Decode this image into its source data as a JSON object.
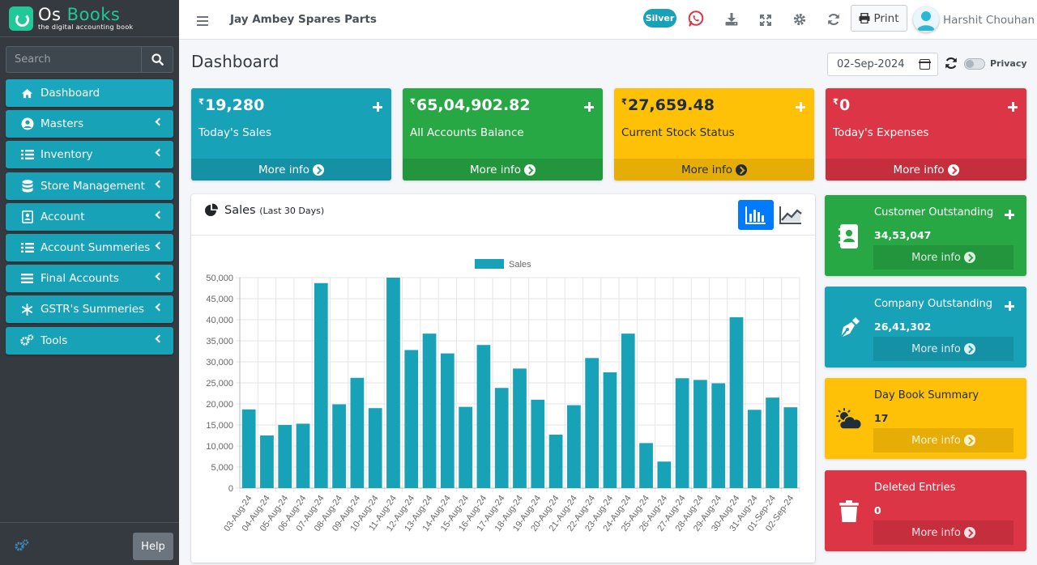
{
  "app": {
    "brand_os": "Os",
    "brand_books": "Books",
    "brand_sub": "the digital accounting book"
  },
  "search": {
    "placeholder": "Search"
  },
  "sidebar": {
    "items": [
      {
        "label": "Dashboard",
        "icon": "home-icon",
        "active": true
      },
      {
        "label": "Masters",
        "icon": "user-circle-icon"
      },
      {
        "label": "Inventory",
        "icon": "list-icon"
      },
      {
        "label": "Store Management",
        "icon": "database-icon"
      },
      {
        "label": "Account",
        "icon": "address-card-icon"
      },
      {
        "label": "Account Summeries",
        "icon": "list-icon"
      },
      {
        "label": "Final Accounts",
        "icon": "bars-icon"
      },
      {
        "label": "GSTR's Summeries",
        "icon": "snowflake-icon"
      },
      {
        "label": "Tools",
        "icon": "cogs-icon"
      }
    ],
    "help_label": "Help"
  },
  "topbar": {
    "company": "Jay Ambey Spares Parts",
    "plan_badge": "Silver",
    "print_label": "Print",
    "user_name": "Harshit Chouhan"
  },
  "content": {
    "title": "Dashboard",
    "date": "02-Sep-2024",
    "privacy_label": "Privacy"
  },
  "small_boxes": [
    {
      "currency": "₹",
      "value": "19,280",
      "label": "Today's Sales",
      "more": "More info",
      "color": "#17a2b8"
    },
    {
      "currency": "₹",
      "value": "65,04,902.82",
      "label": "All Accounts Balance",
      "more": "More info",
      "color": "#28a745"
    },
    {
      "currency": "₹",
      "value": "27,659.48",
      "label": "Current Stock Status",
      "more": "More info",
      "color": "#ffc107"
    },
    {
      "currency": "₹",
      "value": "0",
      "label": "Today's Expenses",
      "more": "More info",
      "color": "#dc3545"
    }
  ],
  "sales_card": {
    "title": "Sales",
    "subtitle": "(Last 30 Days)"
  },
  "chart_data": {
    "type": "bar",
    "series": [
      {
        "name": "Sales",
        "color": "#17a2b8",
        "values": [
          18700,
          12500,
          15000,
          15300,
          48700,
          19900,
          26200,
          19000,
          50000,
          32800,
          36700,
          32000,
          19300,
          34000,
          23800,
          28400,
          21000,
          12700,
          19700,
          30900,
          27500,
          36700,
          10700,
          6300,
          26100,
          25700,
          24900,
          40600,
          18600,
          21500,
          19200
        ]
      }
    ],
    "categories": [
      "03-Aug-24",
      "04-Aug-24",
      "05-Aug-24",
      "06-Aug-24",
      "07-Aug-24",
      "08-Aug-24",
      "09-Aug-24",
      "10-Aug-24",
      "11-Aug-24",
      "12-Aug-24",
      "13-Aug-24",
      "14-Aug-24",
      "15-Aug-24",
      "16-Aug-24",
      "17-Aug-24",
      "18-Aug-24",
      "19-Aug-24",
      "20-Aug-24",
      "21-Aug-24",
      "22-Aug-24",
      "23-Aug-24",
      "24-Aug-24",
      "25-Aug-24",
      "26-Aug-24",
      "27-Aug-24",
      "28-Aug-24",
      "29-Aug-24",
      "30-Aug-24",
      "31-Aug-24",
      "01-Sep-24",
      "02-Sep-24"
    ],
    "ylim": [
      0,
      50000
    ],
    "yticks": [
      "0",
      "5,000",
      "10,000",
      "15,000",
      "20,000",
      "25,000",
      "30,000",
      "35,000",
      "40,000",
      "45,000",
      "50,000"
    ],
    "grid": true,
    "legend": "top-center"
  },
  "info_boxes": [
    {
      "title": "Customer Outstanding",
      "value": "34,53,047",
      "more": "More info",
      "icon": "address-book-icon",
      "color": "#28a745",
      "has_plus": true
    },
    {
      "title": "Company Outstanding",
      "value": "26,41,302",
      "more": "More info",
      "icon": "pen-nib-icon",
      "color": "#17a2b8",
      "has_plus": true
    },
    {
      "title": "Day Book Summary",
      "value": "17",
      "more": "More info",
      "icon": "cloud-sun-icon",
      "color": "#ffc107",
      "has_plus": false
    },
    {
      "title": "Deleted Entries",
      "value": "0",
      "more": "More info",
      "icon": "trash-icon",
      "color": "#dc3545",
      "has_plus": false
    }
  ]
}
